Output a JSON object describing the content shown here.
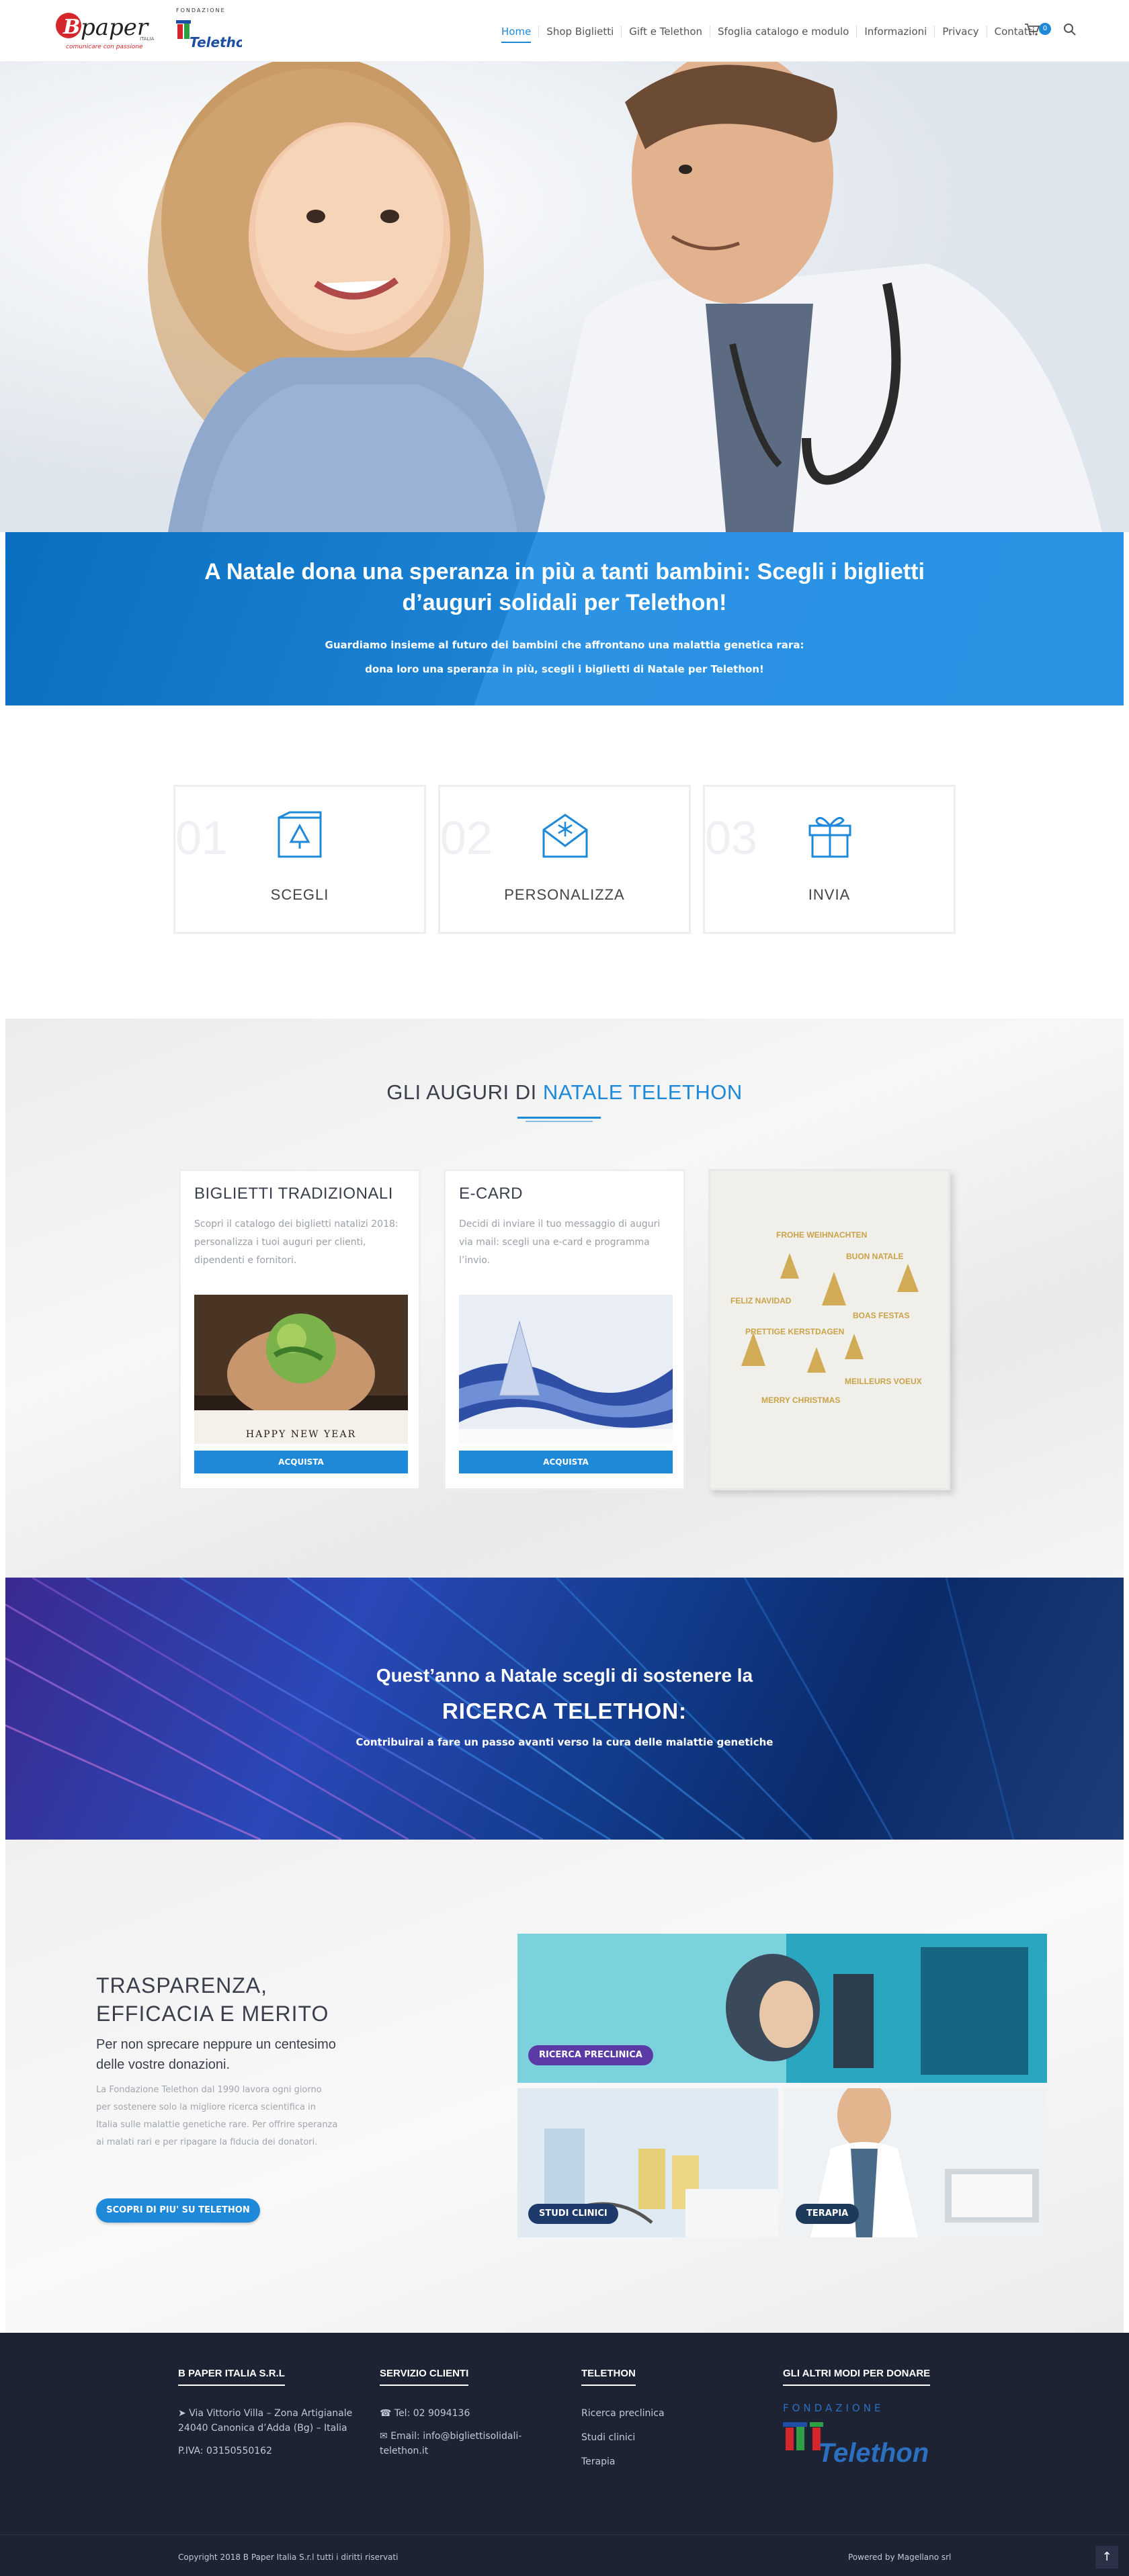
{
  "header": {
    "logo_bpaper": "B paper",
    "logo_bpaper_tagline": "comunicare con passione",
    "logo_telethon_top": "FONDAZIONE",
    "logo_telethon_name": "Telethon",
    "nav": [
      {
        "label": "Home",
        "active": true
      },
      {
        "label": "Shop Biglietti"
      },
      {
        "label": "Gift e Telethon"
      },
      {
        "label": "Sfoglia catalogo e modulo"
      },
      {
        "label": "Informazioni"
      },
      {
        "label": "Privacy"
      },
      {
        "label": "Contatti"
      }
    ],
    "cart_count": "0",
    "icons": {
      "cart": "cart-icon",
      "search": "search-icon"
    }
  },
  "banner": {
    "title": "A Natale dona una speranza in più a tanti bambini: Scegli i biglietti d’auguri solidali per Telethon!",
    "line1": "Guardiamo insieme al futuro dei bambini che affrontano una malattia genetica rara:",
    "line2": "dona loro una speranza in più, scegli i biglietti di Natale per Telethon!"
  },
  "steps": [
    {
      "num": "01",
      "label": "SCEGLI",
      "icon": "card-tree-icon"
    },
    {
      "num": "02",
      "label": "PERSONALIZZA",
      "icon": "envelope-snowflake-icon"
    },
    {
      "num": "03",
      "label": "INVIA",
      "icon": "gift-icon"
    }
  ],
  "auguri": {
    "title_a": "GLI AUGURI DI ",
    "title_b": "NATALE TELETHON",
    "cards": [
      {
        "title": "BIGLIETTI TRADIZIONALI",
        "text": "Scopri il catalogo dei biglietti natalizi 2018: personalizza i tuoi auguri per clienti, dipendenti e fornitori.",
        "button": "ACQUISTA",
        "image_caption": "HAPPY NEW YEAR"
      },
      {
        "title": "E-CARD",
        "text": "Decidi di inviare il tuo messaggio di auguri via mail: scegli una e-card e programma l’invio.",
        "button": "ACQUISTA"
      }
    ],
    "greetings": [
      "FROHE WEIHNACHTEN",
      "BUON NATALE",
      "FELIZ NAVIDAD",
      "BOAS FESTAS",
      "PRETTIGE KERSTDAGEN",
      "MEILLEURS VOEUX",
      "MERRY CHRISTMAS"
    ]
  },
  "ricerca": {
    "line1": "Quest’anno a Natale scegli di sostenere la",
    "line2": "RICERCA TELETHON:",
    "line3": "Contribuirai a fare un passo avanti verso la cura delle malattie genetiche"
  },
  "trasparenza": {
    "title_1": "TRASPARENZA,",
    "title_2": "EFFICACIA E MERITO",
    "subtitle": "Per non sprecare neppure un centesimo delle vostre donazioni.",
    "body": "La Fondazione Telethon dal 1990 lavora ogni giorno per sostenere solo la migliore ricerca scientifica in Italia sulle malattie genetiche rare. Per offrire speranza ai malati rari e per ripagare la fiducia dei donatori.",
    "button": "SCOPRI DI PIU' SU TELETHON",
    "tiles": [
      {
        "label": "RICERCA PRECLINICA",
        "color": "#5b3aa6"
      },
      {
        "label": "STUDI CLINICI",
        "color": "#1e3a6a"
      },
      {
        "label": "TERAPIA",
        "color": "#1e3a5a"
      }
    ]
  },
  "footer": {
    "col1": {
      "title": "B PAPER ITALIA S.R.L",
      "address_1": "Via Vittorio Villa – Zona Artigianale",
      "address_2": "24040 Canonica d’Adda (Bg) – Italia",
      "piva": "P.IVA: 03150550162"
    },
    "col2": {
      "title": "SERVIZIO CLIENTI",
      "tel": "Tel: 02 9094136",
      "email": "Email: info@bigliettisolidali-telethon.it"
    },
    "col3": {
      "title": "TELETHON",
      "links": [
        "Ricerca preclinica",
        "Studi clinici",
        "Terapia"
      ]
    },
    "col4": {
      "title": "GLI ALTRI MODI PER DONARE",
      "logo_top": "FONDAZIONE",
      "logo_name": "Telethon"
    },
    "copyright": "Copyright 2018 B Paper Italia S.r.l tutti i diritti riservati",
    "powered": "Powered by Magellano srl"
  }
}
